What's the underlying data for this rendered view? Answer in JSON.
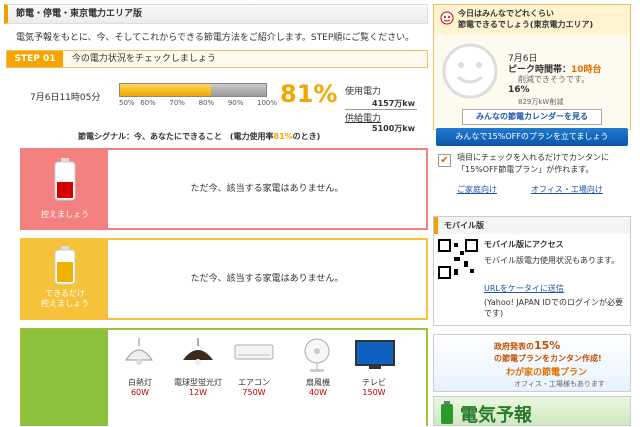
{
  "header": {
    "title": "節電・停電・東京電力エリア版"
  },
  "intro": "電気予報をもとに、今、そしてこれからできる節電方法をご紹介します。STEP順にご覧ください。",
  "step1": {
    "label": "STEP",
    "num": "01",
    "title": "今の電力状況をチェックしましょう"
  },
  "status": {
    "time": "7月6日11時05分",
    "percent": "81%",
    "percent_value": 81,
    "ticks": [
      "50%",
      "60%",
      "70%",
      "80%",
      "90%",
      "100%"
    ],
    "usage_label": "使用電力",
    "usage_value": "4157万kw",
    "supply_label": "供給電力",
    "supply_value": "5100万kw"
  },
  "signal": {
    "text_pre": "節電シグナル：今、あなたにできること　(電力使用率",
    "text_pct": "81%",
    "text_post": "のとき)"
  },
  "cards": [
    {
      "label": "控えましょう",
      "message": "ただ今、該当する家電はありません。",
      "color": "#f48080"
    },
    {
      "label": "できるだけ\n控えましょう",
      "message": "ただ今、該当する家電はありません。",
      "color": "#f5c23a"
    }
  ],
  "appliances": [
    {
      "name": "白熱灯",
      "watt": "60W"
    },
    {
      "name": "電球型蛍光灯",
      "watt": "12W"
    },
    {
      "name": "エアコン",
      "watt": "750W"
    },
    {
      "name": "扇風機",
      "watt": "40W"
    },
    {
      "name": "テレビ",
      "watt": "150W"
    }
  ],
  "right": {
    "title1": "今日はみんなでどれくらい",
    "title2": "節電できるでしょう(東京電力エリア)",
    "date": "7月6日",
    "peak_label": "ピーク時間帯：",
    "peak_value": "10時台",
    "reduce_text": "削減できそうです。",
    "reduce_pct": "16%",
    "reduce_amount": "829万kW削減",
    "calendar_link": "みんなの節電カレンダーを見る",
    "plan_button": "みんなで15%OFFのプランを立てましょう",
    "check_text": "項目にチェックを入れるだけでカンタンに「15%OFF節電プラン」が作れます。",
    "link_home": "ご家庭向け",
    "link_office": "オフィス・工場向け",
    "mobile_title": "モバイル版",
    "mobile_access": "モバイル版にアクセス",
    "mobile_desc": "モバイル版電力使用状況もあります。",
    "mobile_send": "URLをケータイに送信",
    "mobile_note": "(Yahoo! JAPAN IDでのログインが必要です)",
    "banner_text1": "政府発表の",
    "banner_pct": "15%",
    "banner_text2": "の節電プランをカンタン作成!",
    "banner_text3": "わが家の節電プラン",
    "banner_sub": "オフィス・工場様もあります",
    "forecast": "電気予報"
  }
}
